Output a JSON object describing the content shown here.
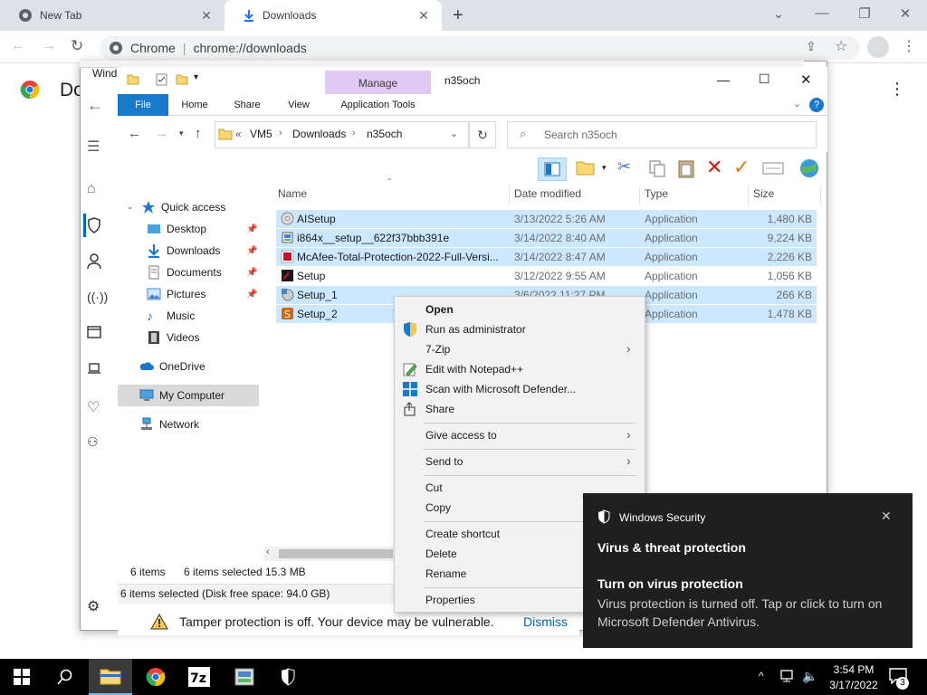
{
  "chrome": {
    "tabs": [
      {
        "title": "New Tab",
        "active": false
      },
      {
        "title": "Downloads",
        "active": true
      }
    ],
    "omnibox": {
      "origin_label": "Chrome",
      "path": "chrome://downloads"
    },
    "page_title_partial": "Do"
  },
  "explorer": {
    "behind_title_partial": "Wind",
    "title": "n35och",
    "ribbon": {
      "context_tab": "Manage",
      "tabs": [
        "File",
        "Home",
        "Share",
        "View",
        "Application Tools"
      ]
    },
    "breadcrumb": {
      "prefix": "«",
      "parts": [
        "VM5",
        "Downloads",
        "n35och"
      ]
    },
    "search_placeholder": "Search n35och",
    "columns": [
      "Name",
      "Date modified",
      "Type",
      "Size"
    ],
    "files": [
      {
        "name": "AISetup",
        "date": "3/13/2022 5:26 AM",
        "type": "Application",
        "size": "1,480 KB",
        "icon": "disc-icon"
      },
      {
        "name": "i864x__setup__622f37bbb391e",
        "date": "3/14/2022 8:40 AM",
        "type": "Application",
        "size": "9,224 KB",
        "icon": "installer-icon"
      },
      {
        "name": "McAfee-Total-Protection-2022-Full-Versi...",
        "date": "3/14/2022 8:47 AM",
        "type": "Application",
        "size": "2,226 KB",
        "icon": "mcafee-icon"
      },
      {
        "name": "Setup",
        "date": "3/12/2022 9:55 AM",
        "type": "Application",
        "size": "1,056 KB",
        "icon": "setup-icon"
      },
      {
        "name": "Setup_1",
        "date": "3/6/2022 11:27 PM",
        "type": "Application",
        "size": "266 KB",
        "icon": "cd-setup-icon"
      },
      {
        "name": "Setup_2",
        "date": "",
        "type": "Application",
        "size": "1,478 KB",
        "icon": "s-app-icon"
      }
    ],
    "nav": {
      "quick_access": "Quick access",
      "items": [
        "Desktop",
        "Downloads",
        "Documents",
        "Pictures",
        "Music",
        "Videos"
      ],
      "onedrive": "OneDrive",
      "my_computer": "My Computer",
      "network": "Network"
    },
    "status": {
      "count": "6 items",
      "selected": "6 items selected",
      "size": "15.3 MB",
      "details": "6 items selected (Disk free space: 94.0 GB)"
    }
  },
  "context_menu": {
    "open": "Open",
    "run_as_admin": "Run as administrator",
    "zip": "7-Zip",
    "notepad": "Edit with Notepad++",
    "defender": "Scan with Microsoft Defender...",
    "share": "Share",
    "give_access": "Give access to",
    "send_to": "Send to",
    "cut": "Cut",
    "copy": "Copy",
    "create_shortcut": "Create shortcut",
    "delete": "Delete",
    "rename": "Rename",
    "properties": "Properties"
  },
  "tamper": {
    "message": "Tamper protection is off. Your device may be vulnerable.",
    "dismiss": "Dismiss"
  },
  "toast": {
    "app": "Windows Security",
    "heading": "Virus & threat protection",
    "subheading": "Turn on virus protection",
    "body": "Virus protection is turned off. Tap or click to turn on Microsoft Defender Antivirus."
  },
  "taskbar": {
    "time": "3:54 PM",
    "date": "3/17/2022",
    "notif_count": "3"
  },
  "colors": {
    "selection": "#cce8ff",
    "manage_tab": "#e2c8f4",
    "file_tab": "#1979ca",
    "toast_bg": "#1f1f1f"
  }
}
